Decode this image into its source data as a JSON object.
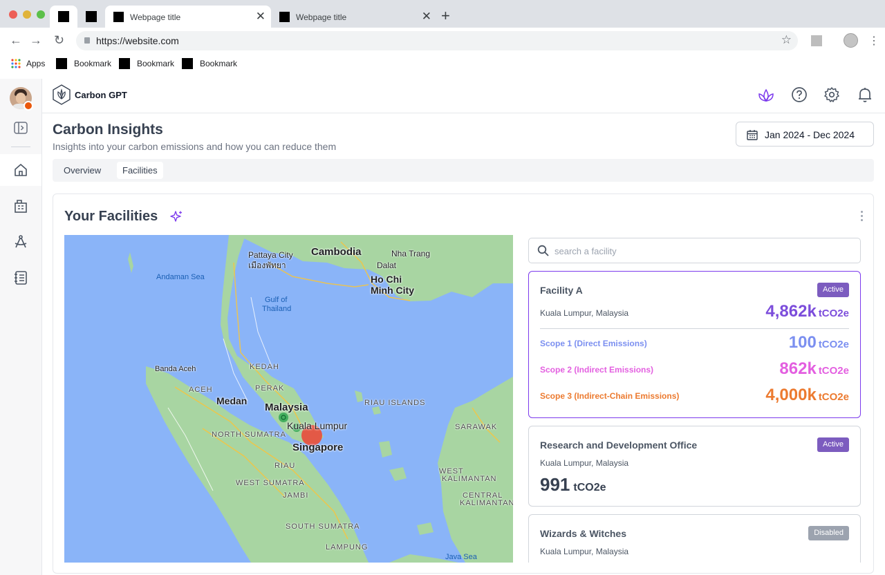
{
  "browser": {
    "tabs": [
      {
        "title": "Webpage title",
        "active": true
      },
      {
        "title": "Webpage title",
        "active": false
      }
    ],
    "url": "https://website.com",
    "bookmarks": {
      "apps_label": "Apps",
      "items": [
        "Bookmark",
        "Bookmark",
        "Bookmark"
      ]
    }
  },
  "app": {
    "brand": "Carbon GPT",
    "page_title": "Carbon Insights",
    "page_subtitle": "Insights into your carbon emissions and how you can reduce them",
    "date_range": "Jan 2024 - Dec 2024",
    "tabs": [
      {
        "label": "Overview",
        "selected": false
      },
      {
        "label": "Facilities",
        "selected": true
      }
    ]
  },
  "facilities_card": {
    "title": "Your Facilities",
    "search_placeholder": "search a facility",
    "map_labels": {
      "cambodia": "Cambodia",
      "pattaya": "Pattaya City",
      "pattaya_thai": "เมืองพัทยา",
      "nha_trang": "Nha Trang",
      "dalat": "Dalat",
      "hcmc_1": "Ho Chi",
      "hcmc_2": "Minh City",
      "andaman": "Andaman Sea",
      "gulf_1": "Gulf of",
      "gulf_2": "Thailand",
      "banda_aceh": "Banda Aceh",
      "aceh": "ACEH",
      "medan": "Medan",
      "kedah": "KEDAH",
      "perak": "PERAK",
      "malaysia": "Malaysia",
      "kuala_lumpur": "Kuala Lumpur",
      "riau_islands": "RIAU ISLANDS",
      "north_sumatra": "NORTH SUMATRA",
      "singapore": "Singapore",
      "riau": "RIAU",
      "west_sumatra": "WEST SUMATRA",
      "jambi": "JAMBI",
      "south_sumatra": "SOUTH SUMATRA",
      "lampung": "LAMPUNG",
      "sarawak": "SARAWAK",
      "west_kal_1": "WEST",
      "west_kal_2": "KALIMANTAN",
      "central_kal_1": "CENTRAL",
      "central_kal_2": "KALIMANTAN",
      "java_sea": "Java Sea"
    },
    "facilities": [
      {
        "name": "Facility A",
        "status": "Active",
        "location": "Kuala Lumpur, Malaysia",
        "total": "4,862k",
        "unit": "tCO2e",
        "scopes": [
          {
            "label": "Scope 1 (Direct Emissions)",
            "value": "100",
            "unit": "tCO2e",
            "color": "#7b8ff0"
          },
          {
            "label": "Scope 2 (Indirect Emissions)",
            "value": "862k",
            "unit": "tCO2e",
            "color": "#e35fe0"
          },
          {
            "label": "Scope 3 (Indirect-Chain Emissions)",
            "value": "4,000k",
            "unit": "tCO2e",
            "color": "#ec7a2f"
          }
        ]
      },
      {
        "name": "Research and Development Office",
        "status": "Active",
        "location": "Kuala Lumpur, Malaysia",
        "total": "991",
        "unit": "tCO2e"
      },
      {
        "name": "Wizards & Witches",
        "status": "Disabled",
        "location": "Kuala Lumpur, Malaysia"
      }
    ]
  },
  "colors": {
    "accent": "#7c5cbf",
    "total_purple": "#7c4ddb",
    "disabled": "#9ca3af"
  }
}
